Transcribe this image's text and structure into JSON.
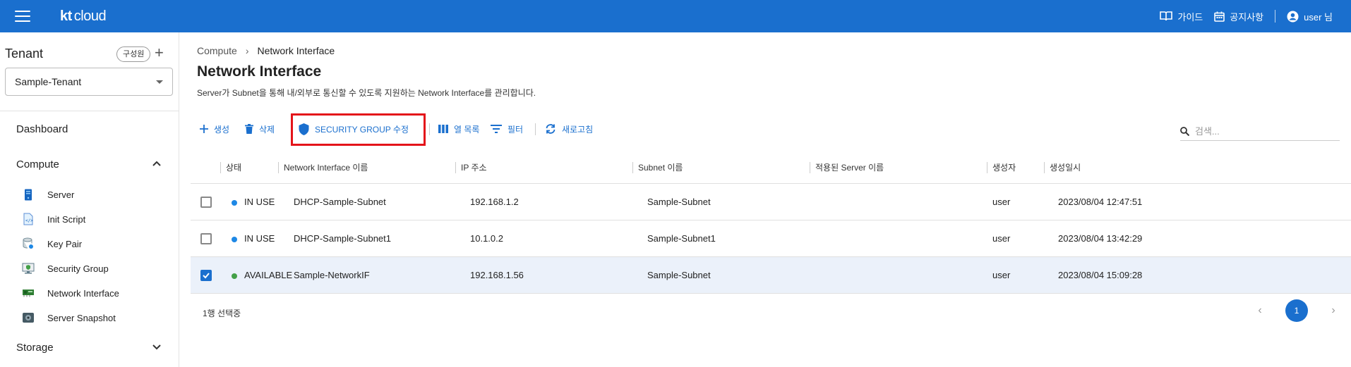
{
  "header": {
    "logo_kt": "kt",
    "logo_cloud": "cloud",
    "guide_label": "가이드",
    "notice_label": "공지사항",
    "user_label": "user 님"
  },
  "sidebar": {
    "tenant_title": "Tenant",
    "member_chip": "구성원",
    "tenant_selected": "Sample-Tenant",
    "dashboard": "Dashboard",
    "compute": "Compute",
    "storage": "Storage",
    "compute_items": [
      {
        "label": "Server",
        "icon": "server-icon"
      },
      {
        "label": "Init Script",
        "icon": "init-script-icon"
      },
      {
        "label": "Key Pair",
        "icon": "key-pair-icon"
      },
      {
        "label": "Security Group",
        "icon": "security-group-icon"
      },
      {
        "label": "Network Interface",
        "icon": "network-interface-icon"
      },
      {
        "label": "Server Snapshot",
        "icon": "server-snapshot-icon"
      }
    ]
  },
  "main": {
    "breadcrumb": [
      "Compute",
      "Network Interface"
    ],
    "title": "Network Interface",
    "description": "Server가 Subnet을 통해 내/외부로 통신할 수 있도록 지원하는 Network Interface를 관리합니다.",
    "toolbar": {
      "create": "생성",
      "delete": "삭제",
      "security_group_edit": "SECURITY GROUP 수정",
      "columns": "열 목록",
      "filter": "필터",
      "refresh": "새로고침"
    },
    "search_placeholder": "검색...",
    "columns": [
      "상태",
      "Network Interface 이름",
      "IP 주소",
      "Subnet 이름",
      "적용된 Server 이름",
      "생성자",
      "생성일시"
    ],
    "rows": [
      {
        "checked": false,
        "status": "IN USE",
        "status_color": "#1e88e5",
        "name": "DHCP-Sample-Subnet",
        "ip": "192.168.1.2",
        "subnet": "Sample-Subnet",
        "server": "",
        "creator": "user",
        "created": "2023/08/04 12:47:51"
      },
      {
        "checked": false,
        "status": "IN USE",
        "status_color": "#1e88e5",
        "name": "DHCP-Sample-Subnet1",
        "ip": "10.1.0.2",
        "subnet": "Sample-Subnet1",
        "server": "",
        "creator": "user",
        "created": "2023/08/04 13:42:29"
      },
      {
        "checked": true,
        "status": "AVAILABLE",
        "status_color": "#43a047",
        "name": "Sample-NetworkIF",
        "ip": "192.168.1.56",
        "subnet": "Sample-Subnet",
        "server": "",
        "creator": "user",
        "created": "2023/08/04 15:09:28"
      }
    ],
    "selection_text": "1행 선택중",
    "current_page": "1"
  },
  "colors": {
    "brand": "#1a6fce",
    "highlight": "#e4141a",
    "selected_row": "#ebf1fa"
  }
}
